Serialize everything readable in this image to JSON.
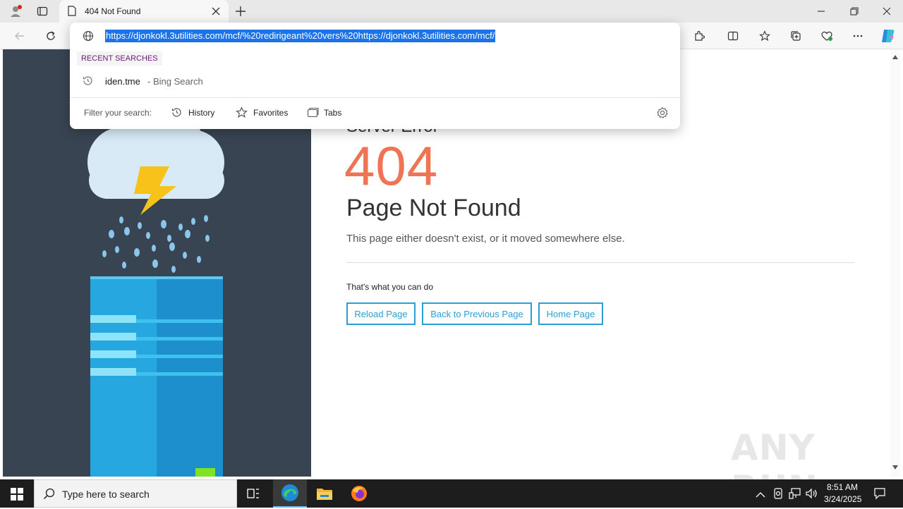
{
  "tab": {
    "title": "404 Not Found"
  },
  "omnibox": {
    "url": "https://djonkokl.3utilities.com/mcf/%20redirigeant%20vers%20https://djonkokl.3utilities.com/mcf/",
    "recent_label": "RECENT SEARCHES",
    "suggestion_text": "iden.tme",
    "suggestion_source": "- Bing Search",
    "filter_label": "Filter your search:",
    "filter_history": "History",
    "filter_favorites": "Favorites",
    "filter_tabs": "Tabs"
  },
  "page": {
    "partial_heading": "Server Error",
    "code": "404",
    "heading": "Page Not Found",
    "description": "This page either doesn't exist, or it moved somewhere else.",
    "actions_label": "That's what you can do",
    "buttons": [
      "Reload Page",
      "Back to Previous Page",
      "Home Page"
    ]
  },
  "watermark": "ANY RUN",
  "taskbar": {
    "search_placeholder": "Type here to search",
    "time": "8:51 AM",
    "date": "3/24/2025"
  },
  "colors": {
    "accent": "#2a9fd6",
    "code": "#ef7454",
    "panel": "#384452",
    "selection": "#1a73e8"
  },
  "icons": {
    "profile": "profile-icon",
    "tab_actions": "tab-actions-icon",
    "page": "page-icon",
    "close": "close-icon",
    "new_tab": "plus-icon",
    "back": "back-arrow-icon",
    "refresh": "refresh-icon",
    "site_info": "globe-icon",
    "history": "history-icon",
    "favorites": "star-icon",
    "tabs": "tabs-icon",
    "settings": "gear-icon"
  }
}
